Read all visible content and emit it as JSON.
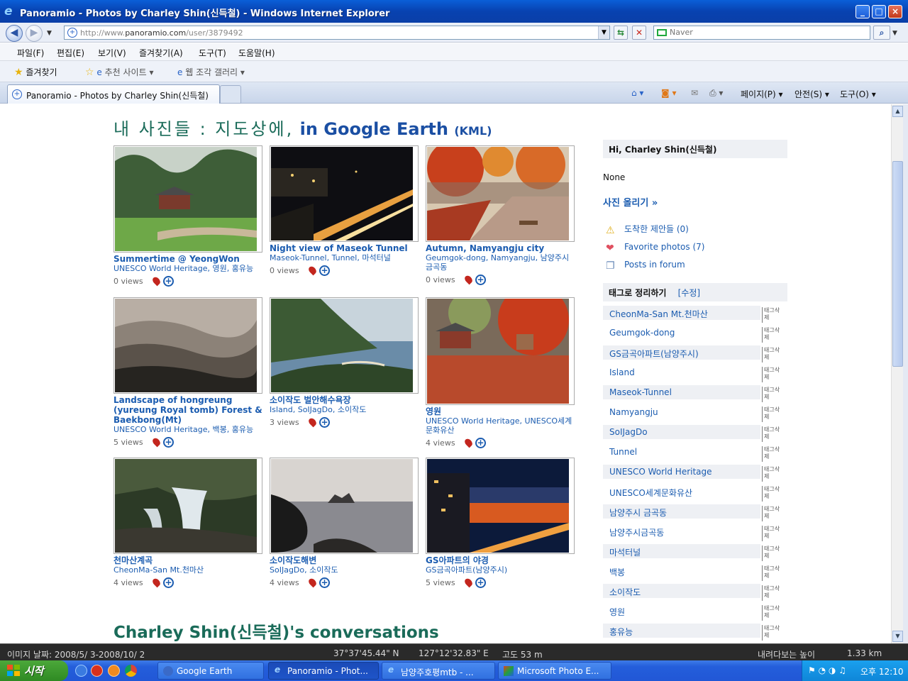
{
  "window": {
    "title": "Panoramio - Photos by Charley Shin(신득철) - Windows Internet Explorer"
  },
  "address": {
    "url_prefix": "http://www.",
    "url_host": "panoramio.com",
    "url_path": "/user/3879492",
    "search_placeholder": "Naver"
  },
  "menu": [
    "파일(F)",
    "편집(E)",
    "보기(V)",
    "즐겨찾기(A)",
    "도구(T)",
    "도움말(H)"
  ],
  "favorites": {
    "label": "즐겨찾기",
    "suggested": "추천 사이트",
    "gallery": "웹 조각 갤러리"
  },
  "tab": {
    "label": "Panoramio - Photos by Charley Shin(신득철)"
  },
  "commands": {
    "page": "페이지(P)",
    "safety": "안전(S)",
    "tools": "도구(O)"
  },
  "page": {
    "heading_ko": "내 사진들 : 지도상에,",
    "heading_en": "in Google Earth",
    "heading_kml": "(KML)",
    "conversations": "Charley Shin(신득철)'s conversations"
  },
  "photos": [
    {
      "title": "Summertime @ YeongWon",
      "tags": "UNESCO World Heritage, 영원, 홍유능",
      "views": "0 views"
    },
    {
      "title": "Night view of Maseok Tunnel",
      "tags": "Maseok-Tunnel, Tunnel, 마석터널",
      "views": "0 views"
    },
    {
      "title": "Autumn, Namyangju city",
      "tags": "Geumgok-dong, Namyangju, 남양주시 금곡동",
      "views": "0 views"
    },
    {
      "title": "Landscape of hongreung (yureung Royal tomb) Forest & Baekbong(Mt)",
      "tags": "UNESCO World Heritage, 백봉, 홍유능",
      "views": "5 views"
    },
    {
      "title": "소이작도 벌안해수욕장",
      "tags": "Island, SoIJagDo, 소이작도",
      "views": "3 views"
    },
    {
      "title": "영원",
      "tags": "UNESCO World Heritage, UNESCO세계문화유산",
      "views": "4 views"
    },
    {
      "title": "천마산계곡",
      "tags": "CheonMa-San Mt.천마산",
      "views": "4 views"
    },
    {
      "title": "소이작도해변",
      "tags": "SoIJagDo, 소이작도",
      "views": "4 views"
    },
    {
      "title": "GS아파트의 야경",
      "tags": "GS금곡아파트(남양주시)",
      "views": "5 views"
    }
  ],
  "sidebar": {
    "greeting": "Hi, Charley Shin(신득철)",
    "none": "None",
    "upload": "사진 올리기 »",
    "suggestions": "도착한 제안들 (0)",
    "favorites": "Favorite photos (7)",
    "posts": "Posts in forum",
    "tags_title": "태그로 정리하기",
    "tags_edit": "[수정]",
    "tag_delete": "태그삭제",
    "tags": [
      "CheonMa-San Mt.천마산",
      "Geumgok-dong",
      "GS금곡아파트(남양주시)",
      "Island",
      "Maseok-Tunnel",
      "Namyangju",
      "SoIJagDo",
      "Tunnel",
      "UNESCO World Heritage",
      "UNESCO세계문화유산",
      "남양주시 금곡동",
      "남양주시금곡동",
      "마석터널",
      "백봉",
      "소이작도",
      "영원",
      "홍유능"
    ]
  },
  "statusbar": {
    "date": "이미지 날짜: 2008/5/ 3-2008/10/ 2",
    "lat": "37°37'45.44\" N",
    "lon": "127°12'32.83\" E",
    "alt": "고도    53 m",
    "eye_label": "내려다보는 높이",
    "eye_value": "1.33 km"
  },
  "taskbar": {
    "start": "시작",
    "tasks": [
      "Google Earth",
      "Panoramio - Phot...",
      "남양주호평mtb - ...",
      "Microsoft Photo E..."
    ],
    "clock": "오후 12:10"
  }
}
